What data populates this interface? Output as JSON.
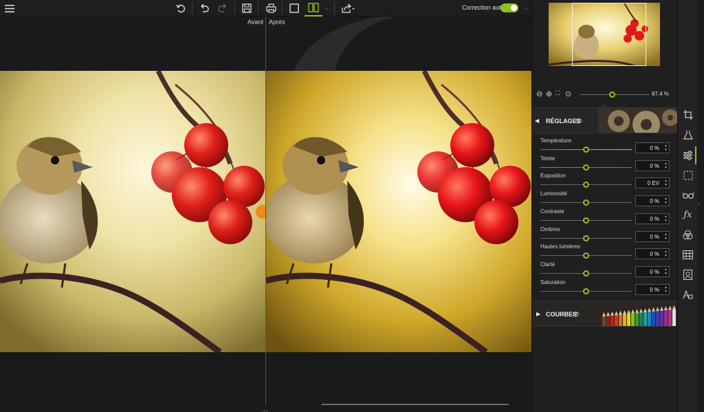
{
  "toolbar": {
    "menu_icon": "hamburger-menu-icon",
    "auto_correction_label": "Correction auto",
    "auto_correction_on": true,
    "accent": "#8dc21f"
  },
  "compare": {
    "before_label": "Avant",
    "after_label": "Après"
  },
  "navigator": {
    "zoom_value": "87,4 %"
  },
  "adjustments": {
    "title": "RÉGLAGES",
    "sliders": [
      {
        "label": "Température",
        "value": "0 %"
      },
      {
        "label": "Teinte",
        "value": "0 %"
      },
      {
        "label": "Exposition",
        "value": "0 EV"
      },
      {
        "label": "Luminosité",
        "value": "0 %"
      },
      {
        "label": "Contraste",
        "value": "0 %"
      },
      {
        "label": "Ombres",
        "value": "0 %"
      },
      {
        "label": "Hautes lumières",
        "value": "0 %"
      },
      {
        "label": "Clarté",
        "value": "0 %"
      },
      {
        "label": "Saturation",
        "value": "0 %"
      }
    ]
  },
  "curves": {
    "title": "COURBES"
  },
  "tools": [
    "crop-icon",
    "flask-icon",
    "sliders-icon",
    "selection-icon",
    "glasses-icon",
    "fx-icon",
    "color-circles-icon",
    "texture-grid-icon",
    "portrait-frame-icon",
    "text-shapes-icon"
  ]
}
